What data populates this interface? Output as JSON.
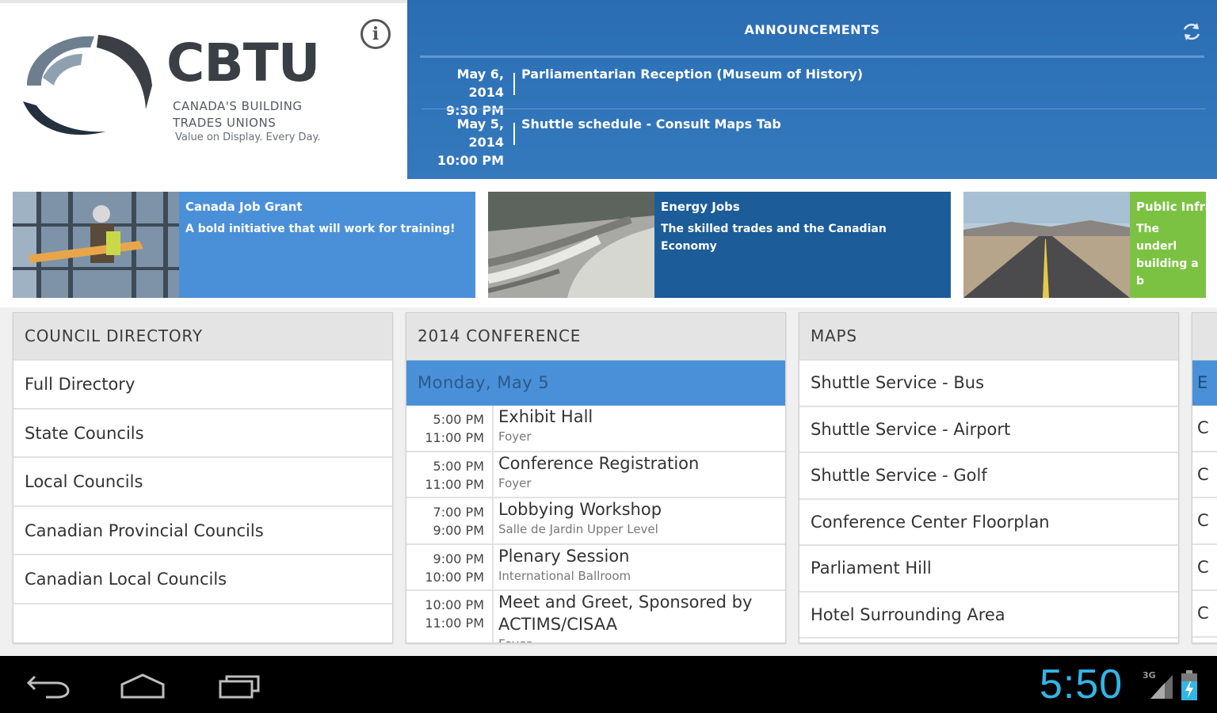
{
  "brand": {
    "name": "CBTU",
    "subtitle_line1": "CANADA'S BUILDING",
    "subtitle_line2": "TRADES UNIONS",
    "tagline": "Value on Display. Every Day."
  },
  "info_icon": "i",
  "announcements": {
    "title": "ANNOUNCEMENTS",
    "items": [
      {
        "date": "May 6, 2014",
        "time": "9:30 PM",
        "text": "Parliamentarian Reception (Museum of History)"
      },
      {
        "date": "May 5, 2014",
        "time": "10:00 PM",
        "text": "Shuttle schedule - Consult Maps Tab"
      }
    ]
  },
  "carousel": [
    {
      "title": "Canada Job Grant",
      "description": "A bold initiative that will work for training!",
      "panel_color": "#4a90d9"
    },
    {
      "title": "Energy Jobs",
      "description": "The skilled trades and the Canadian Economy",
      "panel_color": "#1b5c99"
    },
    {
      "title": "Public Infra",
      "description": "The underl building a b",
      "panel_color": "#7cc242"
    }
  ],
  "council_directory": {
    "header": "COUNCIL DIRECTORY",
    "items": [
      "Full Directory",
      "State Councils",
      "Local Councils",
      "Canadian Provincial Councils",
      "Canadian Local Councils"
    ]
  },
  "conference": {
    "header": "2014 CONFERENCE",
    "day": "Monday, May 5",
    "events": [
      {
        "start": "5:00 PM",
        "end": "11:00 PM",
        "title": "Exhibit Hall",
        "location": "Foyer"
      },
      {
        "start": "5:00 PM",
        "end": "11:00 PM",
        "title": "Conference Registration",
        "location": "Foyer"
      },
      {
        "start": "7:00 PM",
        "end": "9:00 PM",
        "title": "Lobbying Workshop",
        "location": "Salle de Jardin Upper Level"
      },
      {
        "start": "9:00 PM",
        "end": "10:00 PM",
        "title": "Plenary Session",
        "location": "International Ballroom"
      },
      {
        "start": "10:00 PM",
        "end": "11:00 PM",
        "title": "Meet and Greet, Sponsored by ACTIMS/CISAA",
        "location": "Foyer"
      }
    ]
  },
  "maps": {
    "header": "MAPS",
    "items": [
      "Shuttle Service - Bus",
      "Shuttle Service - Airport",
      "Shuttle Service - Golf",
      "Conference Center Floorplan",
      "Parliament Hill",
      "Hotel Surrounding Area"
    ]
  },
  "partial_column": {
    "day_letter": "E",
    "row_letters": [
      "C",
      "C",
      "C",
      "C",
      "C"
    ]
  },
  "system_bar": {
    "clock": "5:50",
    "network": "3G",
    "accent_color": "#33b5e5"
  }
}
